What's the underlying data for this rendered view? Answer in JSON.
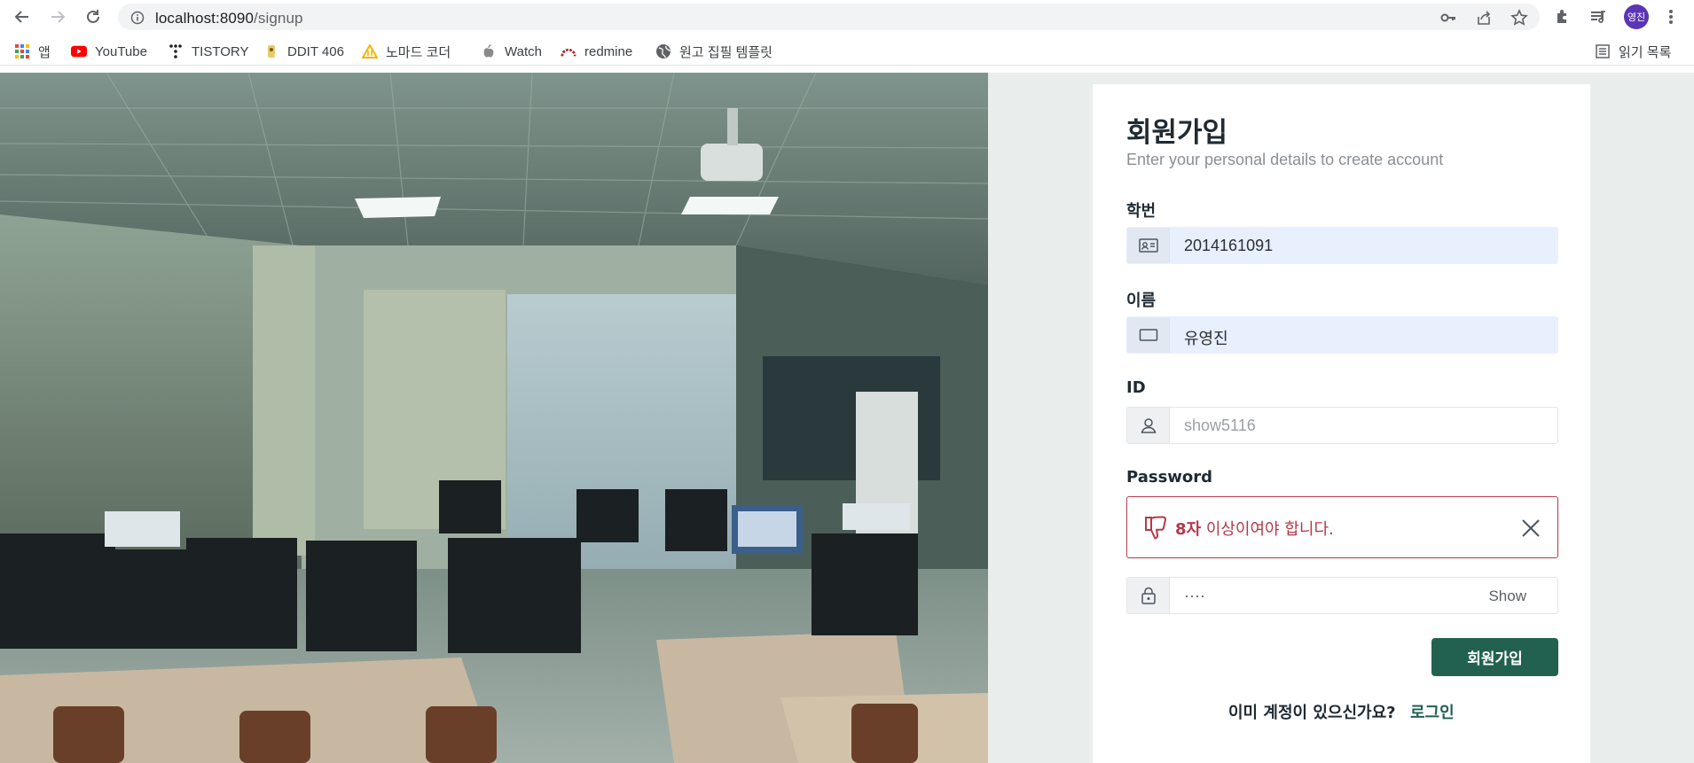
{
  "browser": {
    "url_host": "localhost:8090",
    "url_path": "/signup",
    "profile_initials": "영진",
    "reading_list_label": "읽기 목록"
  },
  "bookmarks": [
    {
      "label": "앱",
      "icon": "apps-grid-icon"
    },
    {
      "label": "YouTube",
      "icon": "youtube-icon"
    },
    {
      "label": "TISTORY",
      "icon": "tistory-icon"
    },
    {
      "label": "DDIT 406",
      "icon": "ddit-icon"
    },
    {
      "label": "노마드 코더",
      "icon": "nomad-icon"
    },
    {
      "label": "Watch",
      "icon": "apple-icon"
    },
    {
      "label": "redmine",
      "icon": "redmine-icon"
    },
    {
      "label": "원고 집필 템플릿",
      "icon": "globe-icon"
    }
  ],
  "form": {
    "title": "회원가입",
    "subtitle": "Enter your personal details to create account",
    "student_id": {
      "label": "학번",
      "value": "2014161091"
    },
    "name": {
      "label": "이름",
      "value": "유영진"
    },
    "user_id": {
      "label": "ID",
      "placeholder": "show5116"
    },
    "password": {
      "label": "Password",
      "alert_bold": "8자",
      "alert_text": " 이상이여야 합니다.",
      "masked_value": "····",
      "show_label": "Show"
    },
    "submit_label": "회원가입",
    "footer_question": "이미 계정이 있으신가요?",
    "login_link": "로그인"
  },
  "colors": {
    "accent": "#22614f",
    "error": "#b3394a",
    "autofill": "#e8f0fe"
  }
}
